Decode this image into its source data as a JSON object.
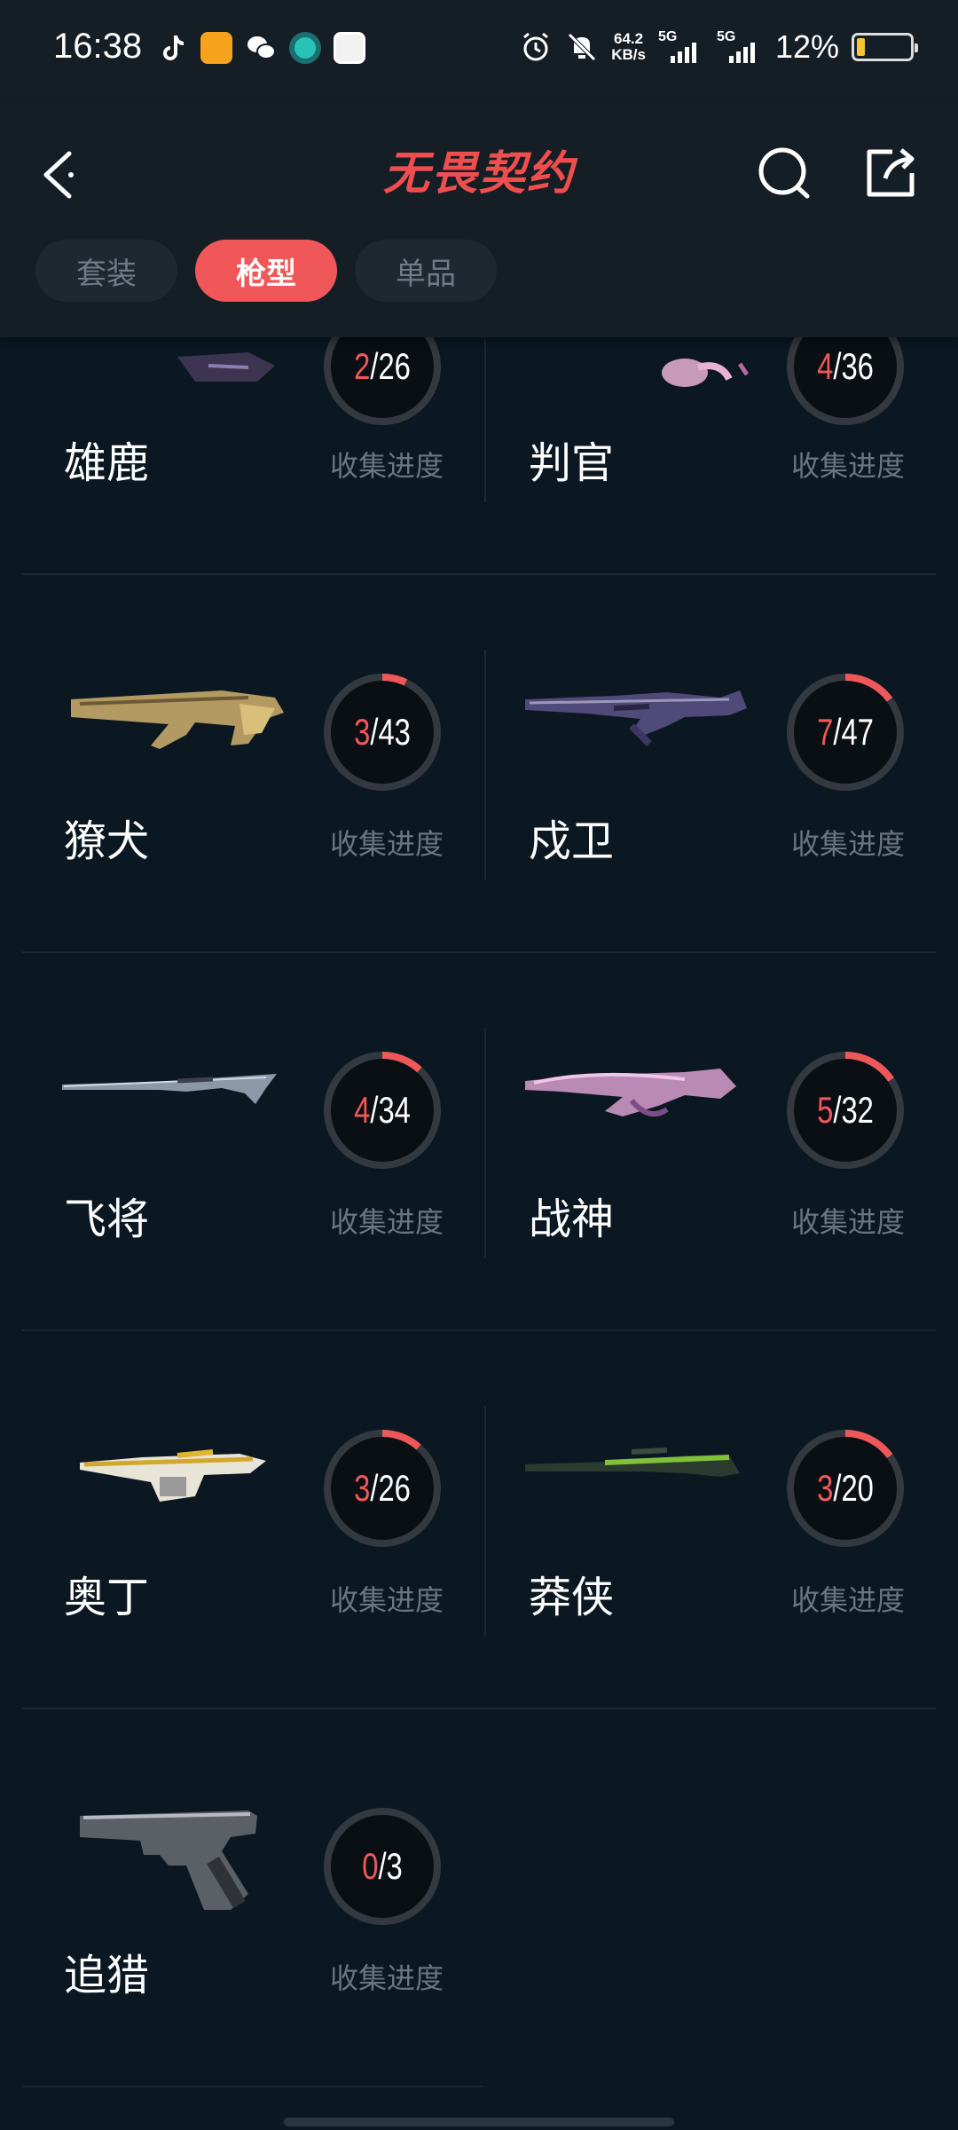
{
  "status_bar": {
    "time": "16:38",
    "speed_value": "64.2",
    "speed_unit": "KB/s",
    "net1": "5G",
    "net2": "5G",
    "battery": "12%",
    "icons": [
      "tiktok-icon",
      "orange-app-icon",
      "wechat-icon",
      "camera-app-icon",
      "avatar-app-icon",
      "alarm-icon",
      "mute-icon"
    ]
  },
  "header": {
    "title": "无畏契约",
    "tabs": [
      {
        "label": "套装",
        "active": false
      },
      {
        "label": "枪型",
        "active": true
      },
      {
        "label": "单品",
        "active": false
      }
    ]
  },
  "progress_label": "收集进度",
  "colors": {
    "accent": "#f05759",
    "background": "#0b1821",
    "header": "#151d25"
  },
  "weapons": [
    {
      "name": "雄鹿",
      "collected": "2",
      "total": "26",
      "progress": 0.077
    },
    {
      "name": "判官",
      "collected": "4",
      "total": "36",
      "progress": 0.111
    },
    {
      "name": "獠犬",
      "collected": "3",
      "total": "43",
      "progress": 0.07
    },
    {
      "name": "戍卫",
      "collected": "7",
      "total": "47",
      "progress": 0.149
    },
    {
      "name": "飞将",
      "collected": "4",
      "total": "34",
      "progress": 0.118
    },
    {
      "name": "战神",
      "collected": "5",
      "total": "32",
      "progress": 0.156
    },
    {
      "name": "奥丁",
      "collected": "3",
      "total": "26",
      "progress": 0.115
    },
    {
      "name": "莽侠",
      "collected": "3",
      "total": "20",
      "progress": 0.15
    },
    {
      "name": "追猎",
      "collected": "0",
      "total": "3",
      "progress": 0
    }
  ]
}
